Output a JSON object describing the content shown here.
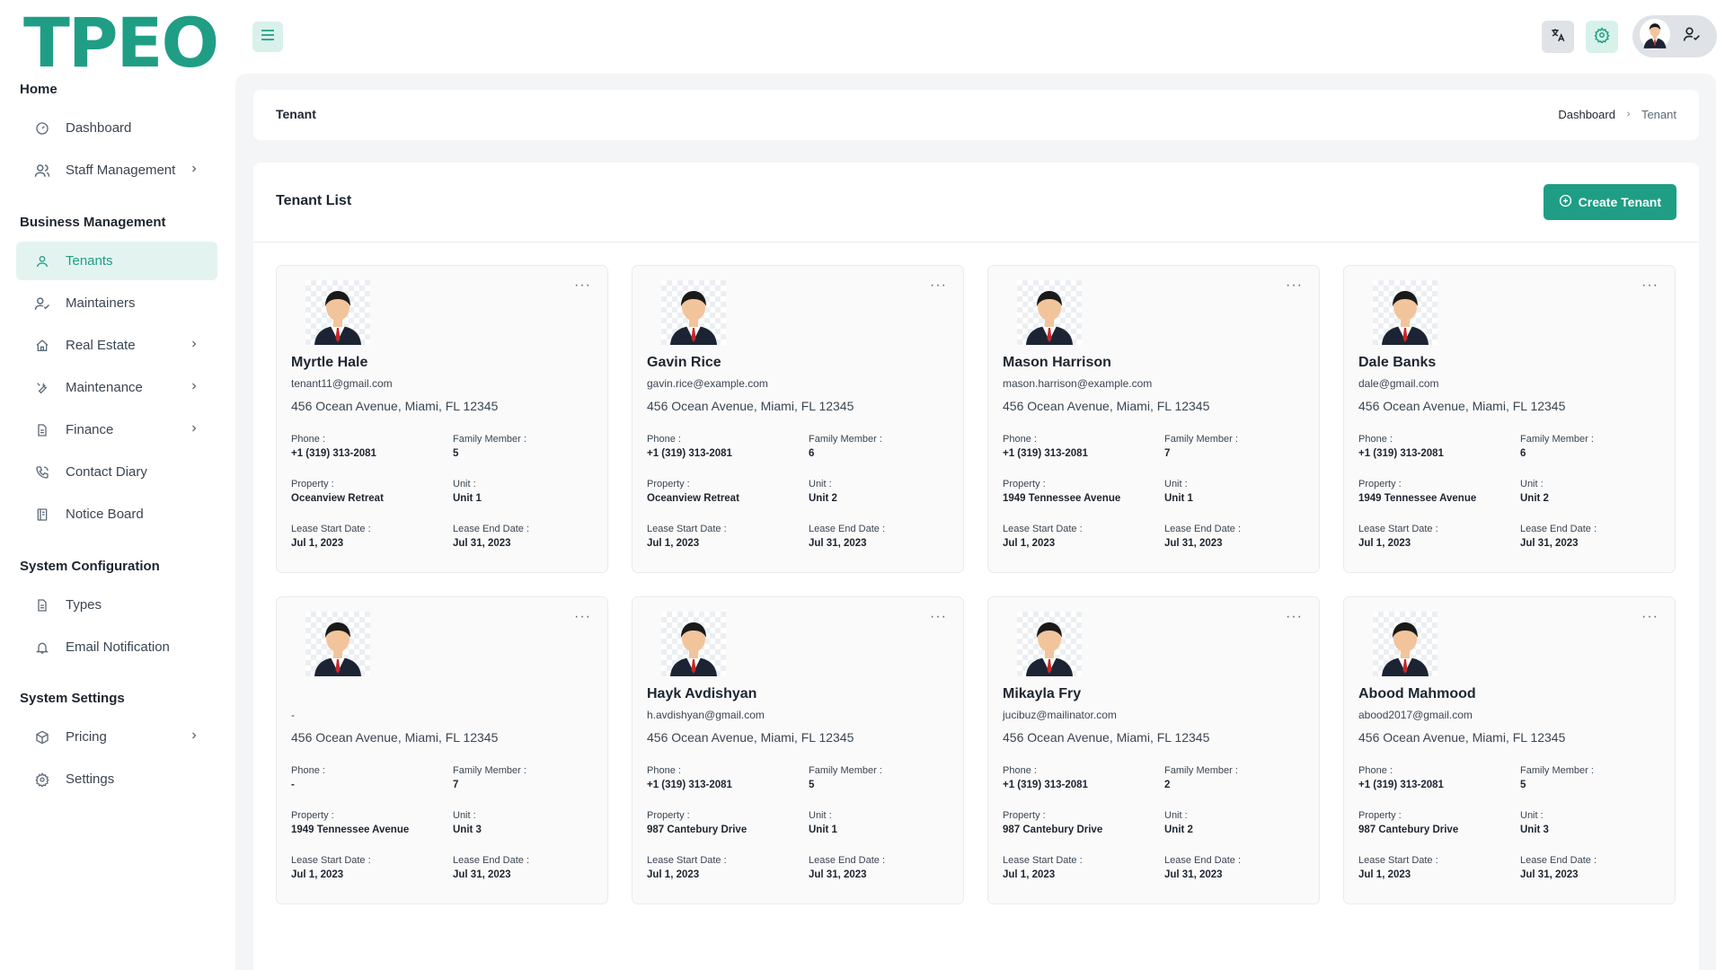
{
  "brand": {
    "logo_text": "TPEO",
    "accent": "#1f9e85"
  },
  "sidebar": {
    "sections": [
      {
        "title": "Home"
      },
      {
        "title": "Business Management"
      },
      {
        "title": "System Configuration"
      },
      {
        "title": "System Settings"
      }
    ],
    "items": [
      {
        "label": "Dashboard",
        "icon": "dashboard-icon",
        "has_submenu": false,
        "active": false
      },
      {
        "label": "Staff Management",
        "icon": "users-icon",
        "has_submenu": true,
        "active": false
      },
      {
        "label": "Tenants",
        "icon": "user-icon",
        "has_submenu": false,
        "active": true
      },
      {
        "label": "Maintainers",
        "icon": "user-check-icon",
        "has_submenu": false,
        "active": false
      },
      {
        "label": "Real Estate",
        "icon": "home-icon",
        "has_submenu": true,
        "active": false
      },
      {
        "label": "Maintenance",
        "icon": "tool-icon",
        "has_submenu": true,
        "active": false
      },
      {
        "label": "Finance",
        "icon": "document-icon",
        "has_submenu": true,
        "active": false
      },
      {
        "label": "Contact Diary",
        "icon": "phone-icon",
        "has_submenu": false,
        "active": false
      },
      {
        "label": "Notice Board",
        "icon": "clipboard-icon",
        "has_submenu": false,
        "active": false
      },
      {
        "label": "Types",
        "icon": "document-icon",
        "has_submenu": false,
        "active": false
      },
      {
        "label": "Email Notification",
        "icon": "bell-icon",
        "has_submenu": false,
        "active": false
      },
      {
        "label": "Pricing",
        "icon": "box-icon",
        "has_submenu": true,
        "active": false
      },
      {
        "label": "Settings",
        "icon": "gear-icon",
        "has_submenu": false,
        "active": false
      }
    ]
  },
  "header": {
    "icons": [
      "menu-icon",
      "translate-icon",
      "gear-icon",
      "avatar",
      "user-check-icon"
    ]
  },
  "page": {
    "title": "Tenant",
    "breadcrumb": [
      "Dashboard",
      "Tenant"
    ]
  },
  "tenant_list": {
    "title": "Tenant List",
    "create_button": "Create Tenant",
    "labels": {
      "phone": "Phone :",
      "family": "Family Member :",
      "property": "Property :",
      "unit": "Unit :",
      "lease_start": "Lease Start Date :",
      "lease_end": "Lease End Date :"
    },
    "tenants": [
      {
        "name": "Myrtle Hale",
        "email": "tenant11@gmail.com",
        "address": "456 Ocean Avenue, Miami, FL 12345",
        "phone": "+1 (319) 313-2081",
        "family": "5",
        "property": "Oceanview Retreat",
        "unit": "Unit 1",
        "lease_start": "Jul 1, 2023",
        "lease_end": "Jul 31, 2023"
      },
      {
        "name": "Gavin Rice",
        "email": "gavin.rice@example.com",
        "address": "456 Ocean Avenue, Miami, FL 12345",
        "phone": "+1 (319) 313-2081",
        "family": "6",
        "property": "Oceanview Retreat",
        "unit": "Unit 2",
        "lease_start": "Jul 1, 2023",
        "lease_end": "Jul 31, 2023"
      },
      {
        "name": "Mason Harrison",
        "email": "mason.harrison@example.com",
        "address": "456 Ocean Avenue, Miami, FL 12345",
        "phone": "+1 (319) 313-2081",
        "family": "7",
        "property": "1949 Tennessee Avenue",
        "unit": "Unit 1",
        "lease_start": "Jul 1, 2023",
        "lease_end": "Jul 31, 2023"
      },
      {
        "name": "Dale Banks",
        "email": "dale@gmail.com",
        "address": "456 Ocean Avenue, Miami, FL 12345",
        "phone": "+1 (319) 313-2081",
        "family": "6",
        "property": "1949 Tennessee Avenue",
        "unit": "Unit 2",
        "lease_start": "Jul 1, 2023",
        "lease_end": "Jul 31, 2023"
      },
      {
        "name": "",
        "email": "-",
        "address": "456 Ocean Avenue, Miami, FL 12345",
        "phone": "-",
        "family": "7",
        "property": "1949 Tennessee Avenue",
        "unit": "Unit 3",
        "lease_start": "Jul 1, 2023",
        "lease_end": "Jul 31, 2023"
      },
      {
        "name": "Hayk Avdishyan",
        "email": "h.avdishyan@gmail.com",
        "address": "456 Ocean Avenue, Miami, FL 12345",
        "phone": "+1 (319) 313-2081",
        "family": "5",
        "property": "987 Cantebury Drive",
        "unit": "Unit 1",
        "lease_start": "Jul 1, 2023",
        "lease_end": "Jul 31, 2023"
      },
      {
        "name": "Mikayla Fry",
        "email": "jucibuz@mailinator.com",
        "address": "456 Ocean Avenue, Miami, FL 12345",
        "phone": "+1 (319) 313-2081",
        "family": "2",
        "property": "987 Cantebury Drive",
        "unit": "Unit 2",
        "lease_start": "Jul 1, 2023",
        "lease_end": "Jul 31, 2023"
      },
      {
        "name": "Abood Mahmood",
        "email": "abood2017@gmail.com",
        "address": "456 Ocean Avenue, Miami, FL 12345",
        "phone": "+1 (319) 313-2081",
        "family": "5",
        "property": "987 Cantebury Drive",
        "unit": "Unit 3",
        "lease_start": "Jul 1, 2023",
        "lease_end": "Jul 31, 2023"
      }
    ]
  }
}
